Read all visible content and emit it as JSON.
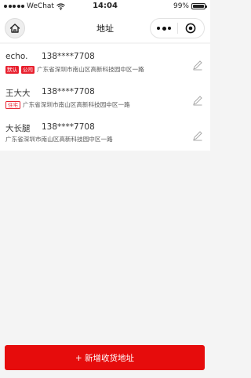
{
  "status_bar": {
    "carrier": "WeChat",
    "time": "14:04",
    "battery": "99%",
    "battery_level": 0.99
  },
  "nav": {
    "title": "地址",
    "home_icon": "home-icon",
    "more_icon": "more-icon",
    "close_icon": "capsule-close-icon"
  },
  "addresses": [
    {
      "name": "echo.",
      "phone": "138****7708",
      "tags": [
        {
          "label": "默认",
          "style": "solid"
        },
        {
          "label": "公司",
          "style": "solid"
        }
      ],
      "address": "广东省深圳市南山区高新科技园中区一路"
    },
    {
      "name": "王大大",
      "phone": "138****7708",
      "tags": [
        {
          "label": "住宅",
          "style": "outline"
        }
      ],
      "address": "广东省深圳市南山区高新科技园中区一路"
    },
    {
      "name": "大长腿",
      "phone": "138****7708",
      "tags": [],
      "address": "广东省深圳市南山区高新科技园中区一路"
    }
  ],
  "add_button": {
    "label": "+ 新增收货地址"
  },
  "colors": {
    "accent": "#e60c0c",
    "tag": "#e8202e",
    "background": "#f4f4f4"
  }
}
